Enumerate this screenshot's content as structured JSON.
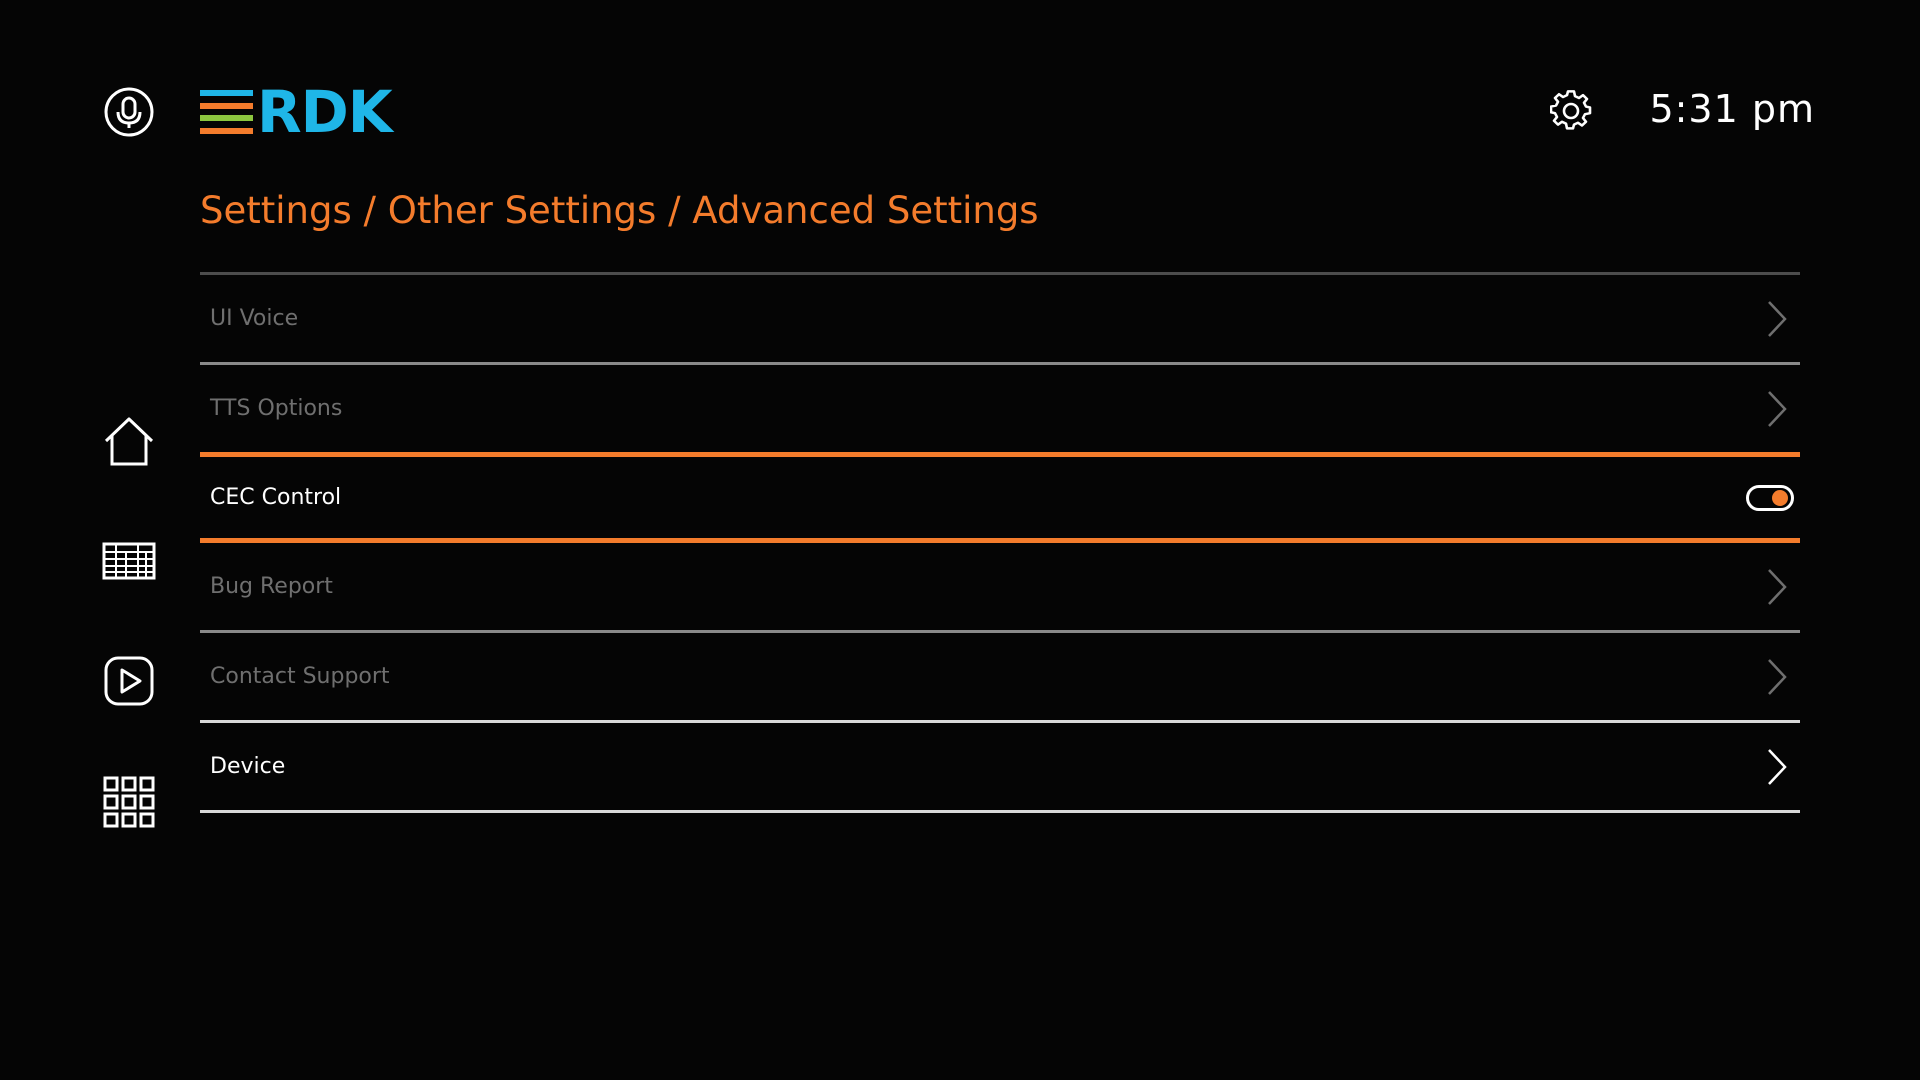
{
  "header": {
    "logo_text": "RDK",
    "clock": "5:31 pm"
  },
  "breadcrumb": "Settings / Other Settings / Advanced Settings",
  "colors": {
    "accent": "#f47c2c",
    "logo_blue": "#1fb6e8",
    "logo_bars": [
      "#1fb6e8",
      "#f47c2c",
      "#8cc63f",
      "#f47c2c"
    ],
    "dim_text": "#6f6f6f"
  },
  "nav": {
    "icons": [
      "microphone-icon",
      "home-icon",
      "tv-guide-icon",
      "play-icon",
      "apps-grid-icon"
    ]
  },
  "menu": {
    "items": [
      {
        "label": "UI Voice",
        "control": "chevron"
      },
      {
        "label": "TTS Options",
        "control": "chevron"
      },
      {
        "label": "CEC Control",
        "control": "toggle",
        "toggle_on": true
      },
      {
        "label": "Bug Report",
        "control": "chevron"
      },
      {
        "label": "Contact Support",
        "control": "chevron"
      },
      {
        "label": "Device",
        "control": "chevron"
      }
    ]
  }
}
